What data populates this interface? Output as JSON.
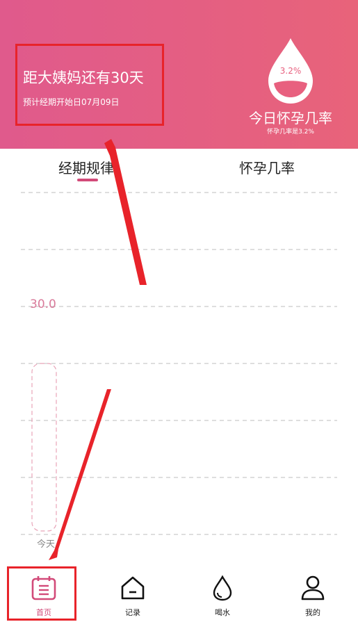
{
  "header": {
    "countdown_title": "距大姨妈还有30天",
    "countdown_sub": "预计经期开始日07月09日",
    "probability_value": "3.2%",
    "pregnancy_label": "今日怀孕几率",
    "pregnancy_sub": "怀孕几率是3.2%"
  },
  "tabs": [
    {
      "label": "经期规律",
      "active": true
    },
    {
      "label": "怀孕几率",
      "active": false
    }
  ],
  "chart_data": {
    "type": "bar",
    "categories": [
      "今天"
    ],
    "values": [
      30.0
    ],
    "value_labels": [
      "30.0"
    ],
    "grid": true
  },
  "nav": [
    {
      "label": "首页",
      "icon": "calendar-icon",
      "active": true
    },
    {
      "label": "记录",
      "icon": "home-icon",
      "active": false
    },
    {
      "label": "喝水",
      "icon": "water-drop-icon",
      "active": false
    },
    {
      "label": "我的",
      "icon": "user-icon",
      "active": false
    }
  ],
  "colors": {
    "header_start": "#e05a8c",
    "header_end": "#e8637a",
    "accent": "#d24a79",
    "annotation": "#e8232a"
  }
}
